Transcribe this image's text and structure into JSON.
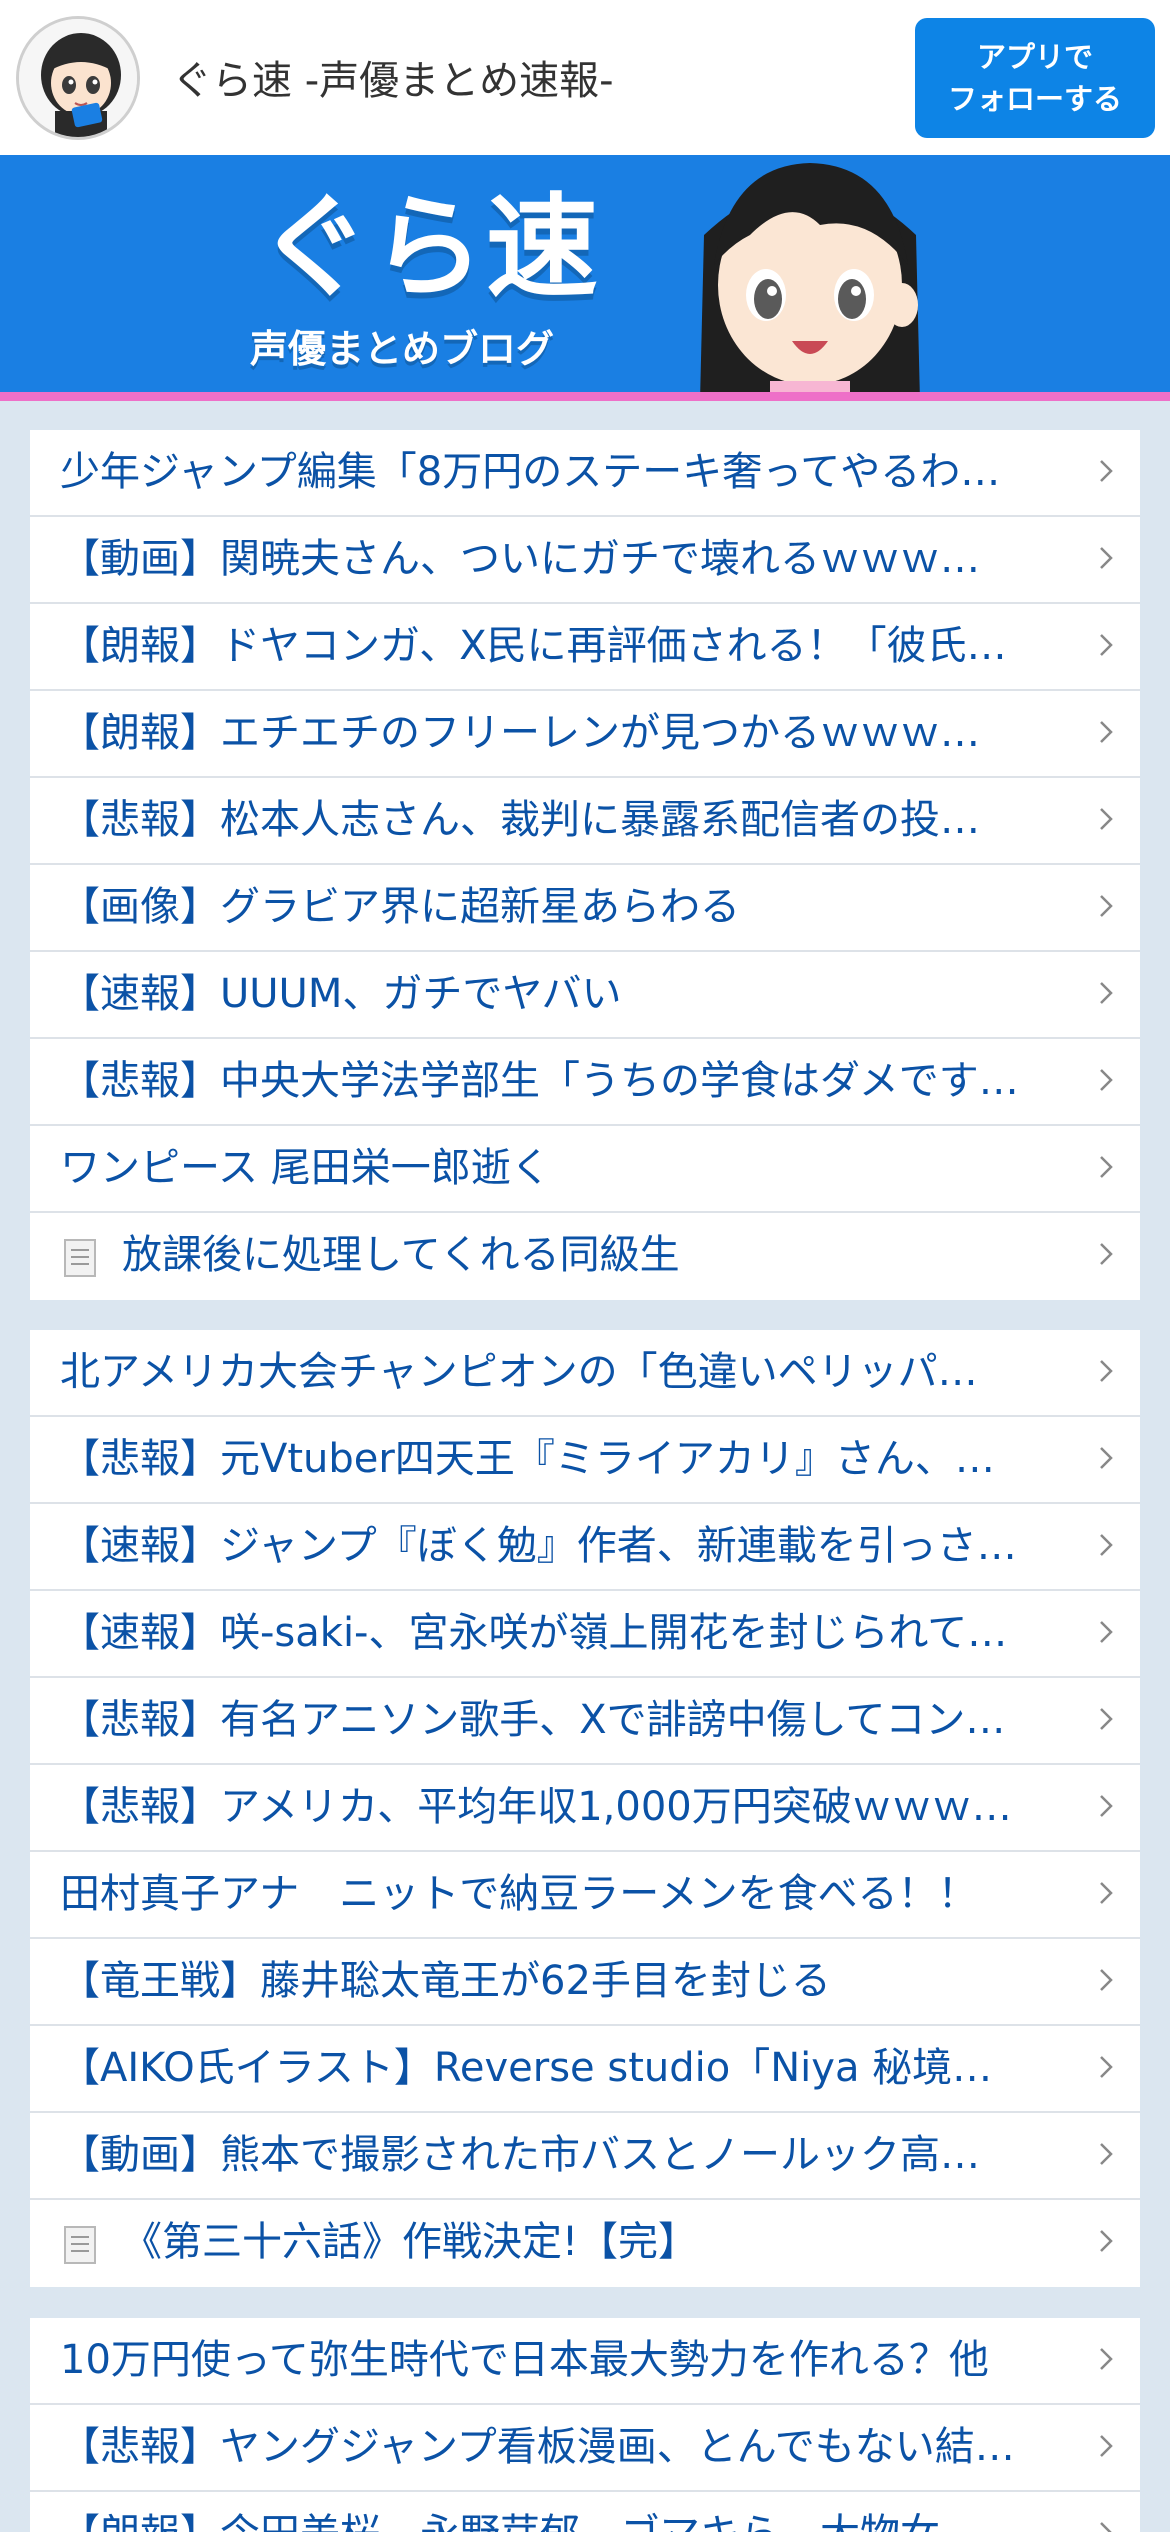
{
  "header": {
    "site_title": "ぐら速 -声優まとめ速報-",
    "follow_button_line1": "アプリで",
    "follow_button_line2": "フォローする"
  },
  "banner": {
    "logo_text": "ぐら速",
    "subtitle": "声優まとめブログ"
  },
  "colors": {
    "accent_blue": "#0d84e6",
    "banner_blue": "#1a7fe3",
    "link_blue": "#0b52a6",
    "pink_stripe": "#ee70c8",
    "page_bg": "#dbe6f0"
  },
  "sections": [
    {
      "items": [
        {
          "title": "少年ジャンプ編集「8万円のステーキ奢ってやるわ…",
          "doc_icon": false
        },
        {
          "title": "【動画】関暁夫さん、ついにガチで壊れるｗｗｗ…",
          "doc_icon": false
        },
        {
          "title": "【朗報】ドヤコンガ、X民に再評価される！「彼氏…",
          "doc_icon": false
        },
        {
          "title": "【朗報】エチエチのフリーレンが見つかるｗｗｗ…",
          "doc_icon": false
        },
        {
          "title": "【悲報】松本人志さん、裁判に暴露系配信者の投…",
          "doc_icon": false
        },
        {
          "title": "【画像】グラビア界に超新星あらわる",
          "doc_icon": false
        },
        {
          "title": "【速報】UUUM、ガチでヤバい",
          "doc_icon": false
        },
        {
          "title": "【悲報】中央大学法学部生「うちの学食はダメです…",
          "doc_icon": false
        },
        {
          "title": "ワンピース 尾田栄一郎逝く",
          "doc_icon": false
        },
        {
          "title": "放課後に処理してくれる同級生",
          "doc_icon": true
        }
      ]
    },
    {
      "items": [
        {
          "title": "北アメリカ大会チャンピオンの「色違いペリッパ…",
          "doc_icon": false
        },
        {
          "title": "【悲報】元Vtuber四天王『ミライアカリ』さん、…",
          "doc_icon": false
        },
        {
          "title": "【速報】ジャンプ『ぼく勉』作者、新連載を引っさ…",
          "doc_icon": false
        },
        {
          "title": "【速報】咲-saki-、宮永咲が嶺上開花を封じられて…",
          "doc_icon": false
        },
        {
          "title": "【悲報】有名アニソン歌手、Xで誹謗中傷してコン…",
          "doc_icon": false
        },
        {
          "title": "【悲報】アメリカ、平均年収1,000万円突破ｗｗｗ…",
          "doc_icon": false
        },
        {
          "title": "田村真子アナ　ニットで納豆ラーメンを食べる！！",
          "doc_icon": false
        },
        {
          "title": "【竜王戦】藤井聡太竜王が62手目を封じる",
          "doc_icon": false
        },
        {
          "title": "【AIKO氏イラスト】Reverse studio「Niya 秘境…",
          "doc_icon": false
        },
        {
          "title": "【動画】熊本で撮影された市バスとノールック高…",
          "doc_icon": false
        },
        {
          "title": "《第三十六話》作戦決定!【完】",
          "doc_icon": true
        }
      ]
    },
    {
      "items": [
        {
          "title": "10万円使って弥生時代で日本最大勢力を作れる？他",
          "doc_icon": false
        },
        {
          "title": "【悲報】ヤングジャンプ看板漫画、とんでもない結…",
          "doc_icon": false
        },
        {
          "title": "【朗報】今田美桜、永野芽郁、ゴマキら、大物女…",
          "doc_icon": false
        }
      ]
    }
  ]
}
